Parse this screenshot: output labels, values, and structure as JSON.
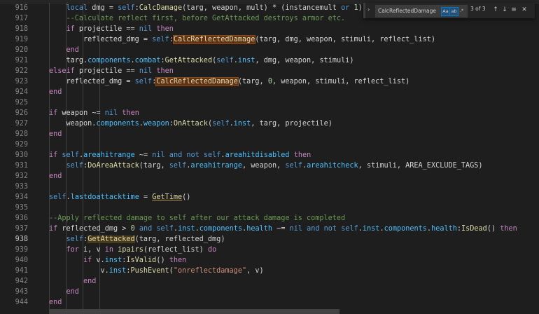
{
  "find_widget": {
    "query": "CalcReflectedDamage",
    "match_case": "Aa",
    "whole_word": "ab",
    "regex": ".*",
    "count": "3 of 3",
    "prev_icon": "arrow-up-icon",
    "next_icon": "arrow-down-icon",
    "selection_icon": "find-in-selection-icon",
    "close_icon": "close-icon",
    "toggle_icon": "chevron-right-icon"
  },
  "editor": {
    "active_line": "938",
    "lines": [
      {
        "num": "916"
      },
      {
        "num": "917"
      },
      {
        "num": "918"
      },
      {
        "num": "919"
      },
      {
        "num": "920"
      },
      {
        "num": "921"
      },
      {
        "num": "922"
      },
      {
        "num": "923"
      },
      {
        "num": "924"
      },
      {
        "num": "925"
      },
      {
        "num": "926"
      },
      {
        "num": "927"
      },
      {
        "num": "928"
      },
      {
        "num": "929"
      },
      {
        "num": "930"
      },
      {
        "num": "931"
      },
      {
        "num": "932"
      },
      {
        "num": "933"
      },
      {
        "num": "934"
      },
      {
        "num": "935"
      },
      {
        "num": "936"
      },
      {
        "num": "937"
      },
      {
        "num": "938"
      },
      {
        "num": "939"
      },
      {
        "num": "940"
      },
      {
        "num": "941"
      },
      {
        "num": "942"
      },
      {
        "num": "943"
      },
      {
        "num": "944"
      }
    ],
    "code": {
      "l916": [
        "local",
        " dmg = ",
        "self",
        ":",
        "CalcDamage",
        "(targ, weapon, mult) * (instancemult ",
        "or",
        " ",
        "1",
        ")"
      ],
      "l917": "--Calculate reflect first, before GetAttacked destroys armor etc.",
      "l918": [
        "if",
        " projectile == ",
        "nil",
        " ",
        "then"
      ],
      "l919": [
        "reflected_dmg = ",
        "self",
        ":",
        "CalcReflectedDamage",
        "(targ, dmg, weapon, stimuli, reflect_list)"
      ],
      "l920": "end",
      "l921": [
        "targ.",
        "components",
        ".",
        "combat",
        ":",
        "GetAttacked",
        "(",
        "self",
        ".",
        "inst",
        ", dmg, weapon, stimuli)"
      ],
      "l922": [
        "elseif",
        " projectile == ",
        "nil",
        " ",
        "then"
      ],
      "l923": [
        "reflected_dmg = ",
        "self",
        ":",
        "CalcReflectedDamage",
        "(targ, ",
        "0",
        ", weapon, stimuli, reflect_list)"
      ],
      "l924": "end",
      "l926": [
        "if",
        " weapon ~= ",
        "nil",
        " ",
        "then"
      ],
      "l927": [
        "weapon.",
        "components",
        ".",
        "weapon",
        ":",
        "OnAttack",
        "(",
        "self",
        ".",
        "inst",
        ", targ, projectile)"
      ],
      "l928": "end",
      "l930": [
        "if",
        " ",
        "self",
        ".",
        "areahitrange",
        " ~= ",
        "nil",
        " and not ",
        "self",
        ".",
        "areahitdisabled",
        " ",
        "then"
      ],
      "l931": [
        "self",
        ":",
        "DoAreaAttack",
        "(targ, ",
        "self",
        ".",
        "areahitrange",
        ", weapon, ",
        "self",
        ".",
        "areahitcheck",
        ", stimuli, AREA_EXCLUDE_TAGS)"
      ],
      "l932": "end",
      "l934": [
        "self",
        ".",
        "lastdoattacktime",
        " = ",
        "GetTime",
        "()"
      ],
      "l936": "--Apply reflected damage to self after our attack damage is completed",
      "l937": [
        "if",
        " reflected_dmg > ",
        "0",
        " and ",
        "self",
        ".",
        "inst",
        ".",
        "components",
        ".",
        "health",
        " ~= ",
        "nil",
        " and not ",
        "self",
        ".",
        "inst",
        ".",
        "components",
        ".",
        "health",
        ":",
        "IsDead",
        "() ",
        "then"
      ],
      "l938": [
        "self",
        ":",
        "GetAttacked",
        "(targ, reflected_dmg)"
      ],
      "l939": [
        "for",
        " i, v ",
        "in",
        " ",
        "ipairs",
        "(reflect_list) ",
        "do"
      ],
      "l940": [
        "if",
        " v.",
        "inst",
        ":",
        "IsValid",
        "() ",
        "then"
      ],
      "l941": [
        "v.",
        "inst",
        ":",
        "PushEvent",
        "(",
        "\"onreflectdamage\"",
        ", v)"
      ],
      "l942": "end",
      "l943": "end",
      "l944": "end"
    }
  },
  "colors": {
    "background": "#1e1e1e",
    "keyword": "#569cd6",
    "control": "#c586c0",
    "function": "#dcdcaa",
    "string": "#ce9178",
    "number": "#b5cea8",
    "comment": "#6a9955",
    "match_highlight": "#613214"
  }
}
